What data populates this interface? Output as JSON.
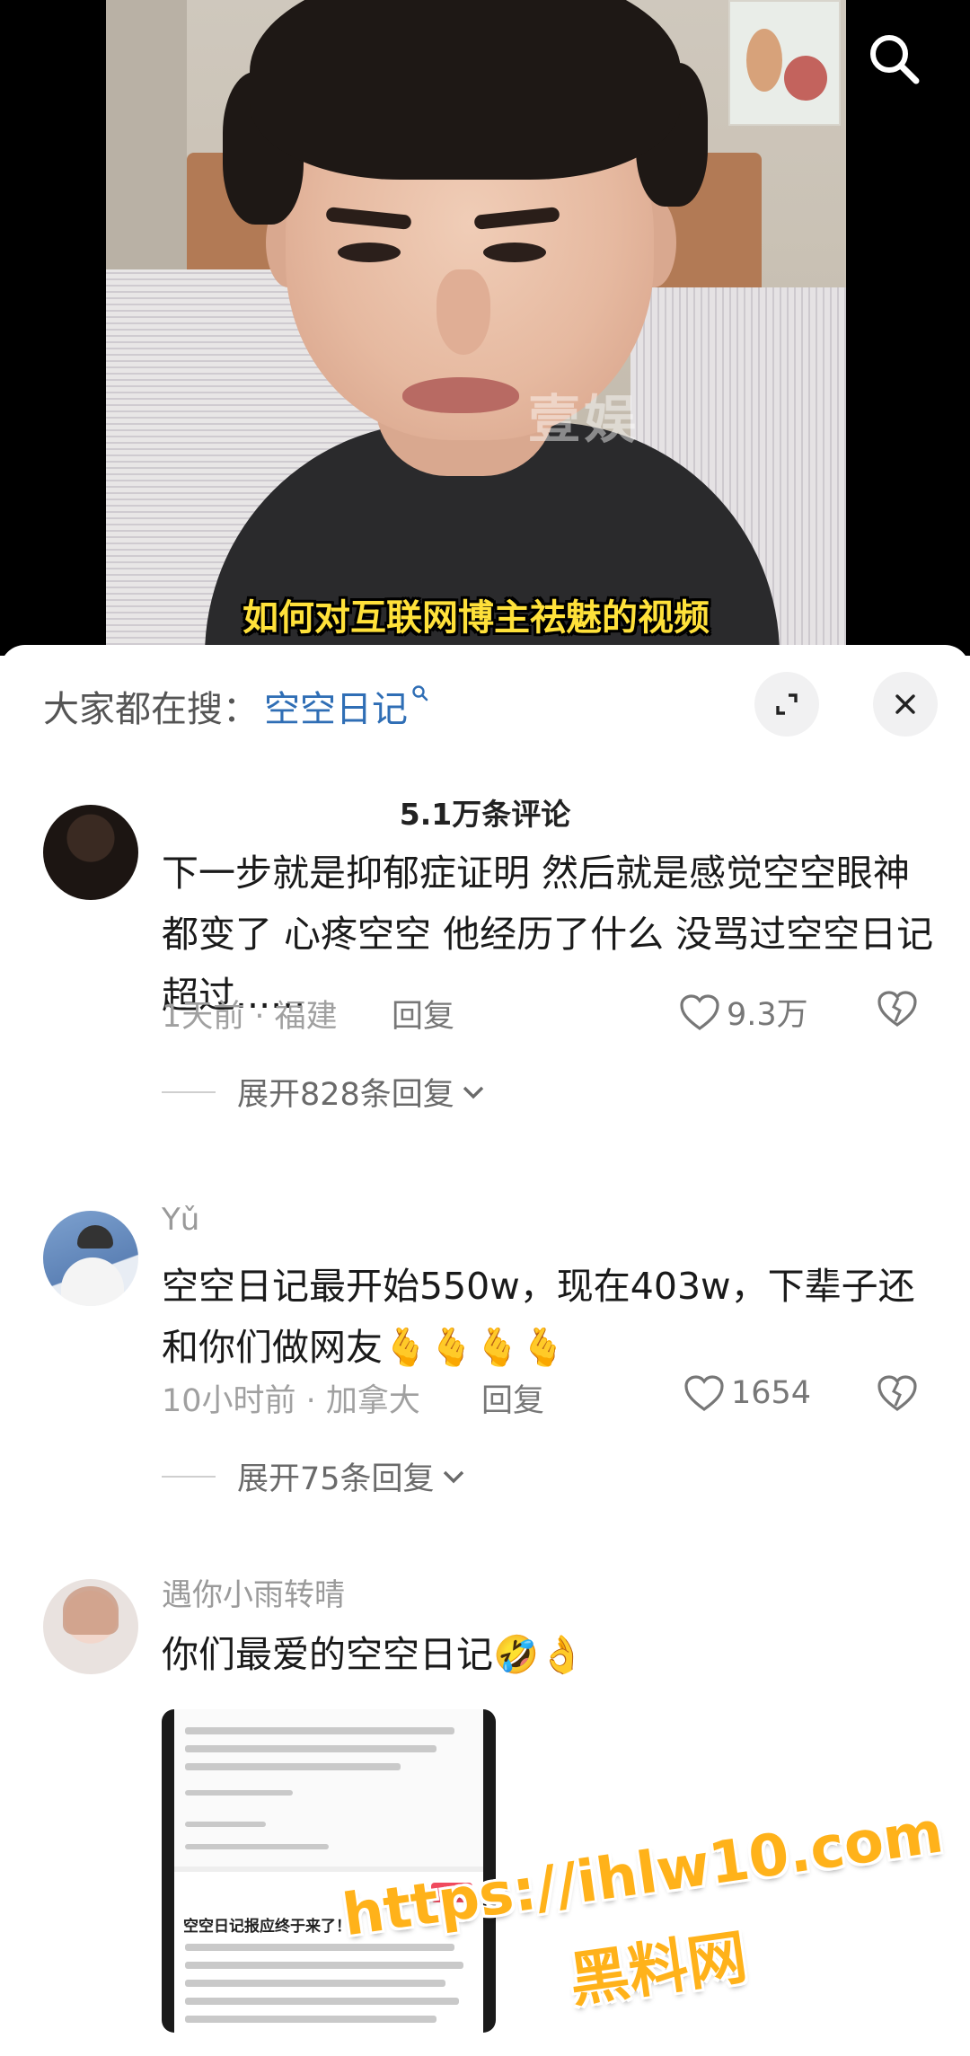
{
  "video": {
    "subtitle": "如何对互联网博主祛魅的视频",
    "watermark_text": "壹娱",
    "search_icon": "search-icon"
  },
  "search_bar": {
    "prefix": "大家都在搜：",
    "term": "空空日记",
    "term_icon": "small-search-icon",
    "expand_icon": "expand-icon",
    "close_icon": "close-icon"
  },
  "comments_count": "5.1万条评论",
  "comments": [
    {
      "name": "",
      "text": "下一步就是抑郁症证明 然后就是感觉空空眼神都变了 心疼空空 他经历了什么 没骂过空空日记超过......",
      "time_location": "1天前 · 福建",
      "reply_label": "回复",
      "likes": "9.3万",
      "expand_label": "展开828条回复"
    },
    {
      "name": "Yǔ",
      "text": "空空日记最开始550w，现在403w，下辈子还和你们做网友🫰🫰🫰🫰",
      "time_location": "10小时前 · 加拿大",
      "reply_label": "回复",
      "likes": "1654",
      "expand_label": "展开75条回复"
    },
    {
      "name": "遇你小雨转晴",
      "text": "你们最爱的空空日记🤣👌",
      "image_title": "空空日记报应终于来了！"
    }
  ],
  "watermark": {
    "url": "https://ihlw10.com",
    "label": "黑料网"
  },
  "colors": {
    "search_term": "#2f6eb5",
    "subtitle": "#ffe13a",
    "watermark": "#ffb21a"
  }
}
